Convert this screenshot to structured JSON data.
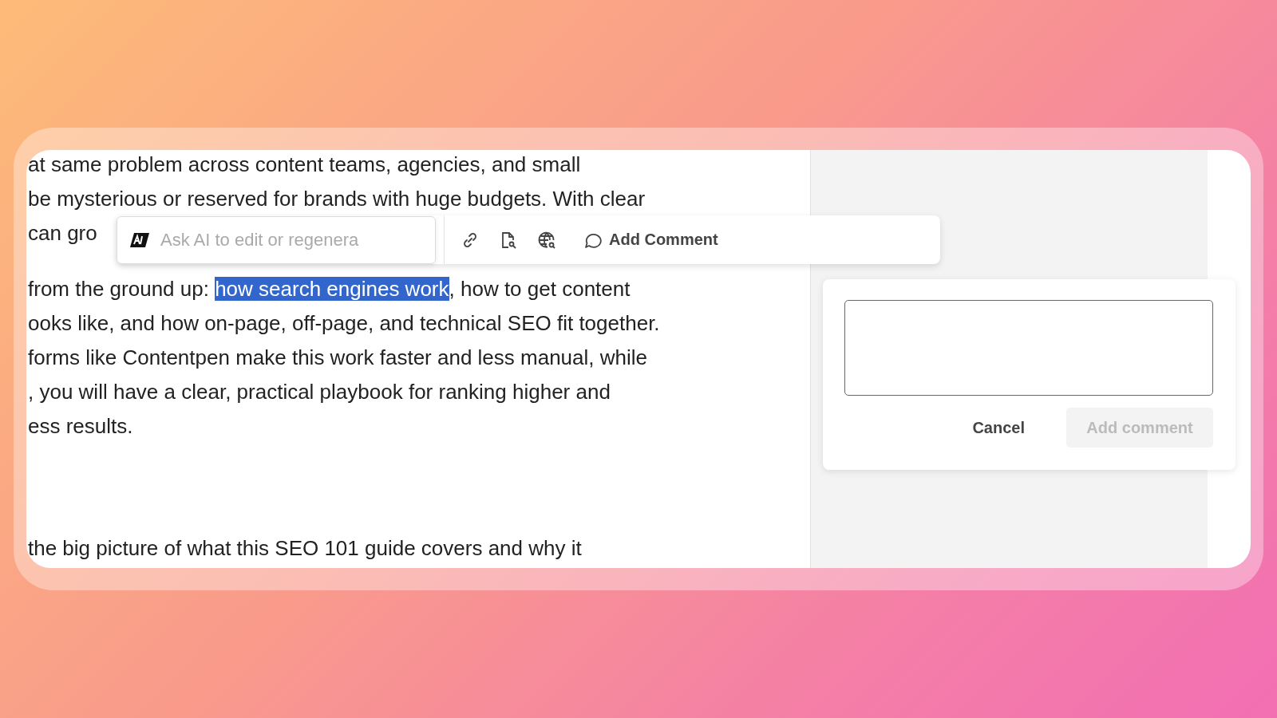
{
  "document": {
    "paragraphs": [
      {
        "lines": [
          {
            "segments": [
              {
                "text": "at same problem across content teams, agencies, and small",
                "selected": false
              }
            ]
          },
          {
            "segments": [
              {
                "text": "be mysterious or reserved for brands with huge budgets. With clear",
                "selected": false
              }
            ]
          },
          {
            "segments": [
              {
                "text": "can gro",
                "selected": false
              }
            ]
          }
        ]
      },
      {
        "lines": [
          {
            "segments": [
              {
                "text": "from the ground up: ",
                "selected": false
              },
              {
                "text": "how search engines work",
                "selected": true
              },
              {
                "text": ", how to get content",
                "selected": false
              }
            ]
          },
          {
            "segments": [
              {
                "text": "ooks like, and how on-page, off-page, and technical SEO fit together.",
                "selected": false
              }
            ]
          },
          {
            "segments": [
              {
                "text": "forms like Contentpen make this work faster and less manual, while",
                "selected": false
              }
            ]
          },
          {
            "segments": [
              {
                "text": ", you will have a clear, practical playbook for ranking higher and",
                "selected": false
              }
            ]
          },
          {
            "segments": [
              {
                "text": "ess results.",
                "selected": false
              }
            ]
          }
        ]
      },
      {
        "lines": [
          {
            "segments": [
              {
                "text": "the big picture of what this SEO 101 guide covers and why it",
                "selected": false
              }
            ]
          }
        ]
      }
    ]
  },
  "toolbar": {
    "ai_prompt": {
      "placeholder": "Ask AI to edit or regenera"
    },
    "add_comment": "Add Comment"
  },
  "comment_popup": {
    "buttons": [
      {
        "label": "Cancel",
        "disabled": false,
        "kind": "secondary"
      },
      {
        "label": "Add comment",
        "disabled": true,
        "kind": "primary"
      }
    ]
  }
}
